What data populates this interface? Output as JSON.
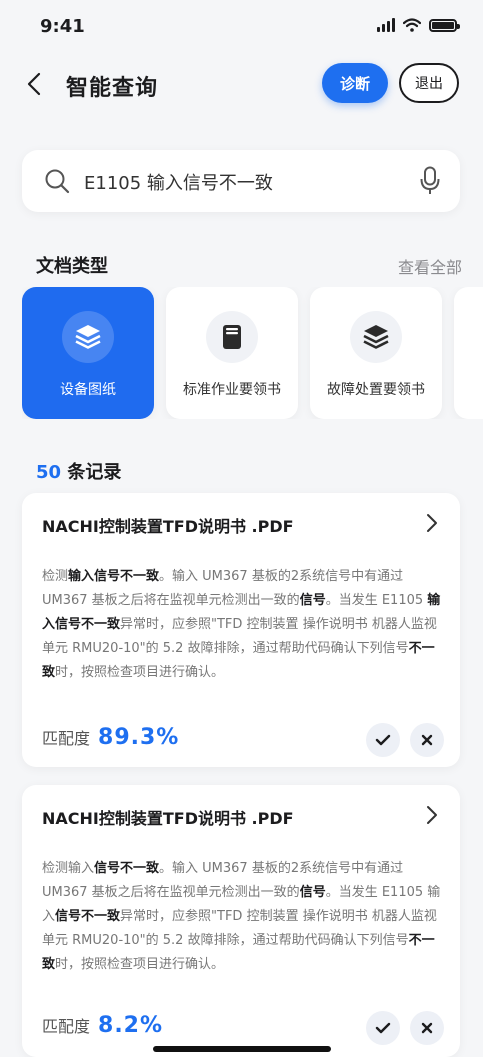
{
  "status": {
    "time": "9:41"
  },
  "nav": {
    "title": "智能查询",
    "primary_button": "诊断",
    "secondary_button": "退出"
  },
  "search": {
    "query": "E1105 输入信号不一致"
  },
  "doc_types": {
    "title": "文档类型",
    "view_all": "查看全部",
    "items": [
      {
        "label": "设备图纸",
        "icon": "stack-layers-icon",
        "active": true
      },
      {
        "label": "标准作业要领书",
        "icon": "document-icon",
        "active": false
      },
      {
        "label": "故障处置要领书",
        "icon": "stack-layers-icon",
        "active": false
      }
    ]
  },
  "results": {
    "count": "50",
    "count_suffix": " 条记录",
    "items": [
      {
        "title": "NACHI控制装置TFD说明书 .PDF",
        "snippet": [
          {
            "t": "检测",
            "b": false
          },
          {
            "t": "输入信号不一致",
            "b": true
          },
          {
            "t": "。输入 UM367 基板的2系统信号中有通过 UM367 基板之后将在监视单元检测出一致的",
            "b": false
          },
          {
            "t": "信号",
            "b": true
          },
          {
            "t": "。当发生 E1105 ",
            "b": false
          },
          {
            "t": "输入信号不一致",
            "b": true
          },
          {
            "t": "异常时，应参照\"TFD 控制装置 操作说明书 机器人监视单元 RMU20-10\"的 5.2 故障排除，通过帮助代码确认下列信号",
            "b": false
          },
          {
            "t": "不一致",
            "b": true
          },
          {
            "t": "时，按照检查项目进行确认。",
            "b": false
          }
        ],
        "match_label": "匹配度",
        "match_value": "89.3%"
      },
      {
        "title": "NACHI控制装置TFD说明书 .PDF",
        "snippet": [
          {
            "t": "检测输入",
            "b": false
          },
          {
            "t": "信号不一致",
            "b": true
          },
          {
            "t": "。输入 UM367 基板的2系统信号中有通过 UM367 基板之后将在监视单元检测出一致的",
            "b": false
          },
          {
            "t": "信号",
            "b": true
          },
          {
            "t": "。当发生 E1105 输入",
            "b": false
          },
          {
            "t": "信号不一致",
            "b": true
          },
          {
            "t": "异常时，应参照\"TFD 控制装置 操作说明书 机器人监视单元 RMU20-10\"的 5.2 故障排除，通过帮助代码确认下列信号",
            "b": false
          },
          {
            "t": "不一致",
            "b": true
          },
          {
            "t": "时，按照检查项目进行确认。",
            "b": false
          }
        ],
        "match_label": "匹配度",
        "match_value": "8.2%"
      }
    ]
  },
  "colors": {
    "accent": "#1e6ff0",
    "card_active": "#1f6bef",
    "background": "#f5f6f8"
  }
}
